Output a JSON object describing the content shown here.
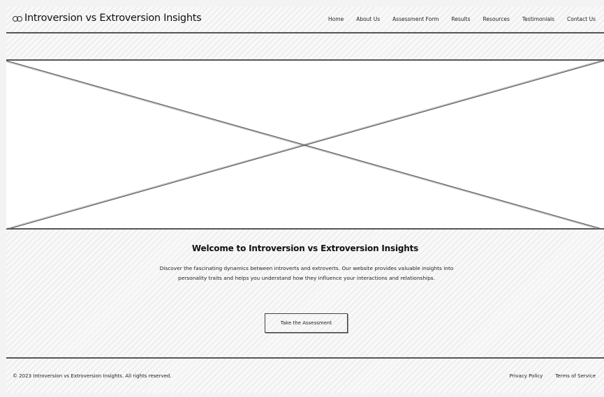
{
  "header": {
    "brand_icon": "two-circles-icon",
    "title": "Introversion vs Extroversion Insights",
    "nav": [
      "Home",
      "About Us",
      "Assessment Form",
      "Results",
      "Resources",
      "Testimonials",
      "Contact Us"
    ]
  },
  "hero": {
    "image_placeholder": "image-placeholder"
  },
  "main": {
    "headline": "Welcome to Introversion vs Extroversion Insights",
    "intro": "Discover the fascinating dynamics between introverts and extroverts. Our website provides valuable insights into personality traits and helps you understand how they influence your interactions and relationships.",
    "cta_label": "Take the Assessment"
  },
  "footer": {
    "copyright": "© 2023 Introversion vs Extroversion Insights. All rights reserved.",
    "links": [
      "Privacy Policy",
      "Terms of Service"
    ]
  },
  "colors": {
    "line": "#555555",
    "text": "#222222",
    "background": "#f8f8f8"
  }
}
